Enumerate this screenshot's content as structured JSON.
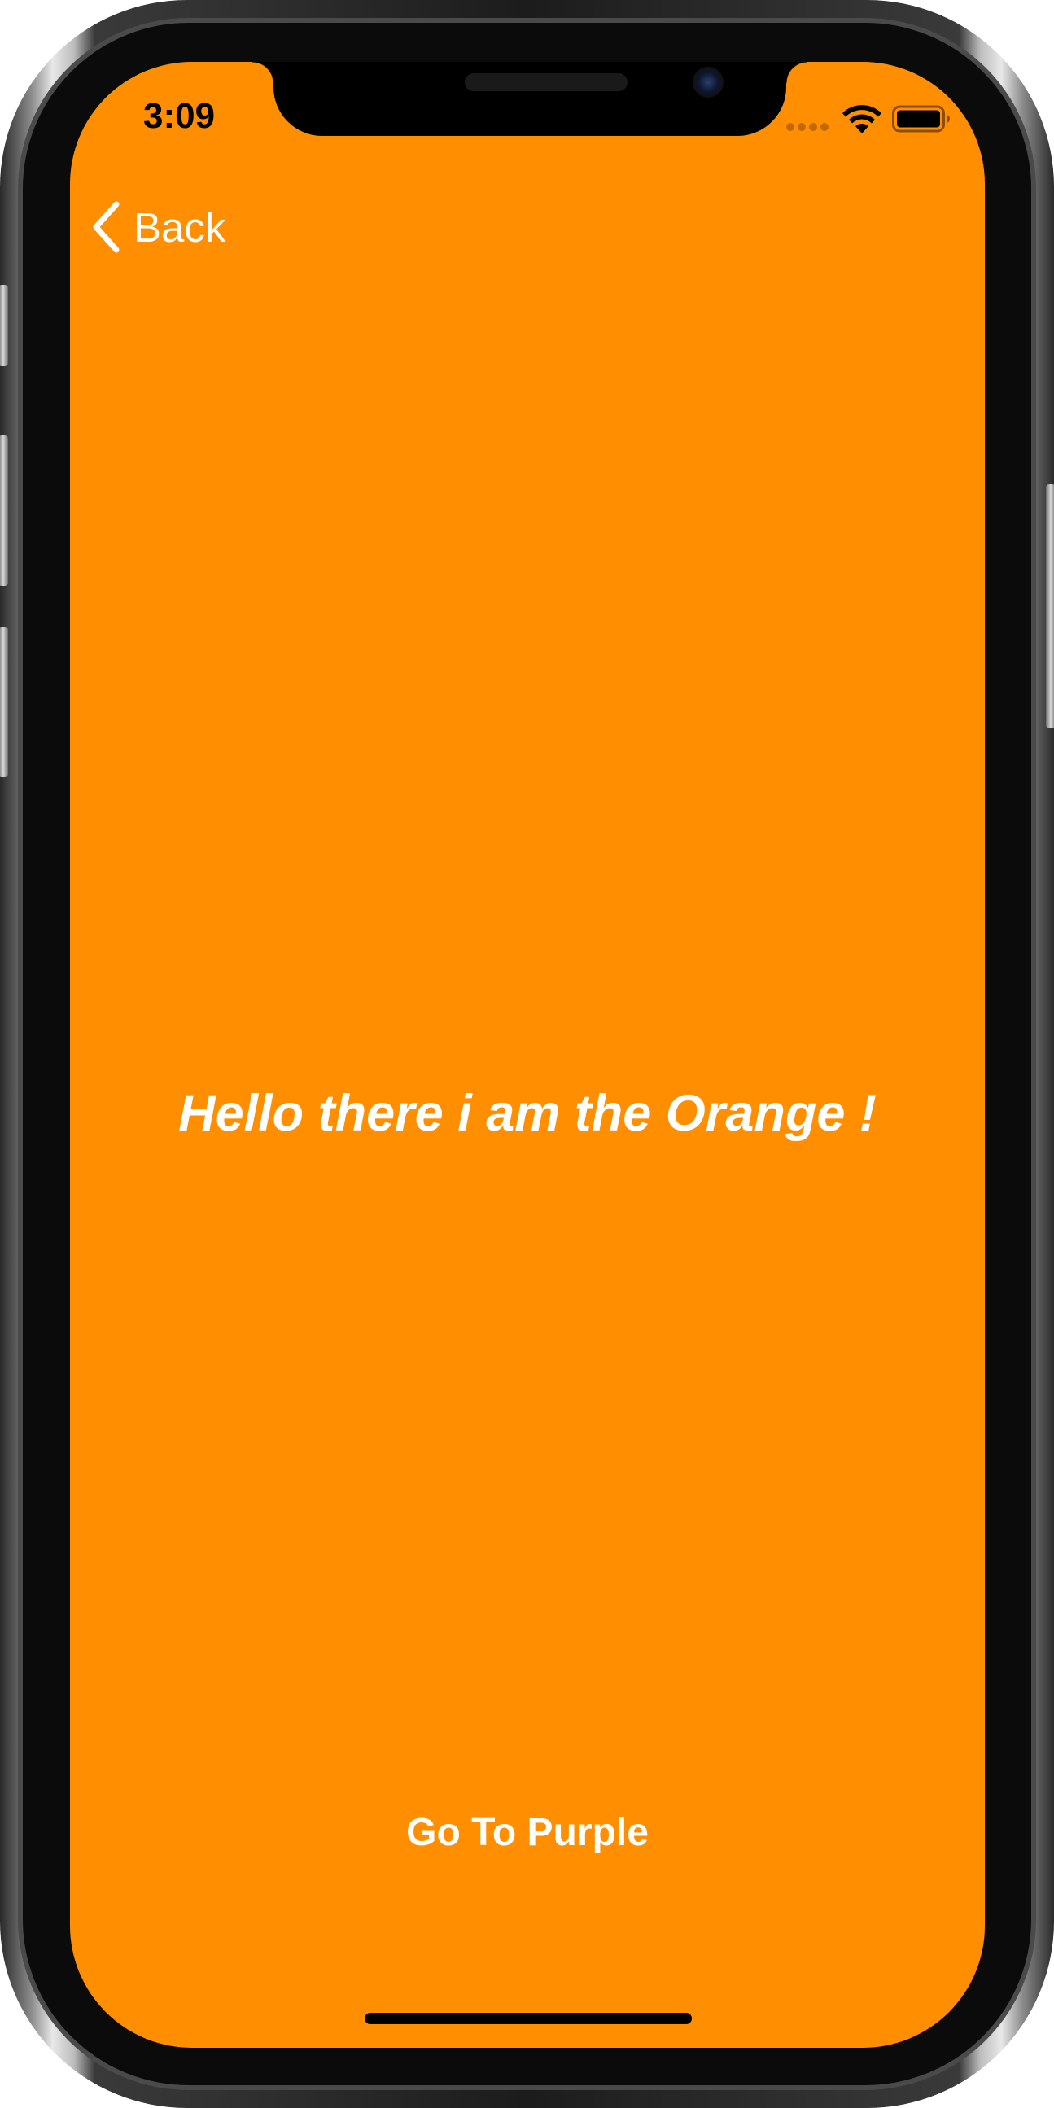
{
  "status_bar": {
    "time": "3:09"
  },
  "nav": {
    "back_label": "Back"
  },
  "main": {
    "message": "Hello there i am the Orange !",
    "action_label": "Go To Purple"
  },
  "colors": {
    "background": "#ff8e00",
    "text": "#ffffff"
  },
  "icons": [
    "chevron-left-icon",
    "wifi-icon",
    "battery-icon"
  ]
}
